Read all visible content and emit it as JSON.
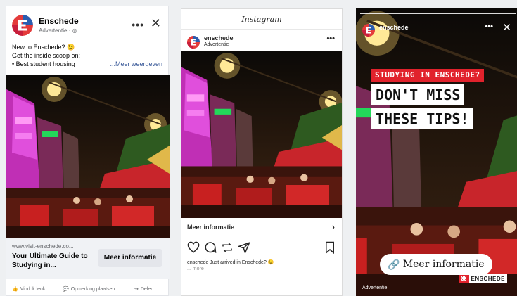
{
  "facebook": {
    "page_name": "Enschede",
    "sponsored": "Advertentie · ",
    "post_lines": [
      "New to Enschede? 😉",
      "Get the inside scoop on:",
      "• Best student housing"
    ],
    "see_more": "...Meer weergeven",
    "link_domain": "www.visit-enschede.co...",
    "link_headline": "Your Ultimate Guide to Studying in...",
    "cta_label": "Meer informatie",
    "actions": [
      "Vind ik leuk",
      "Opmerking plaatsen",
      "Delen"
    ]
  },
  "instagram": {
    "brand": "Instagram",
    "account": "enschede",
    "sponsored": "Advertentie",
    "cta_label": "Meer informatie",
    "caption": "enschede Just arrived in Enschede? 😉",
    "caption_more": "... more"
  },
  "story": {
    "account": "enschede",
    "tag": "STUDYING IN ENSCHEDE?",
    "headline_1": "DON'T MISS",
    "headline_2": "THESE TIPS!",
    "cta_label": "Meer informatie",
    "sponsored": "Advertentie",
    "brand_name": "ENSCHEDE"
  },
  "colors": {
    "accent_red": "#e1222c",
    "fb_link": "#385898",
    "neon_pink": "#d53fd0"
  }
}
